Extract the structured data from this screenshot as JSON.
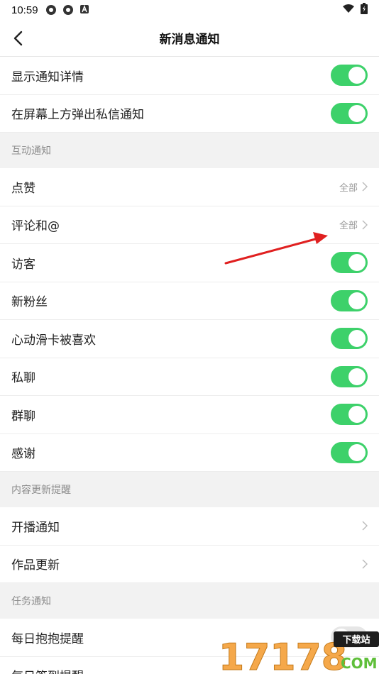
{
  "status": {
    "time": "10:59"
  },
  "nav": {
    "title": "新消息通知"
  },
  "general": [
    {
      "label": "显示通知详情",
      "on": true
    },
    {
      "label": "在屏幕上方弹出私信通知",
      "on": true
    }
  ],
  "interaction": {
    "header": "互动通知",
    "items": [
      {
        "label": "点赞",
        "value": "全部"
      },
      {
        "label": "评论和@",
        "value": "全部"
      },
      {
        "label": "访客",
        "on": true
      },
      {
        "label": "新粉丝",
        "on": true
      },
      {
        "label": "心动滑卡被喜欢",
        "on": true
      },
      {
        "label": "私聊",
        "on": true
      },
      {
        "label": "群聊",
        "on": true
      },
      {
        "label": "感谢",
        "on": true
      }
    ]
  },
  "content_updates": {
    "header": "内容更新提醒",
    "items": [
      {
        "label": "开播通知"
      },
      {
        "label": "作品更新"
      }
    ]
  },
  "tasks": {
    "header": "任务通知",
    "items": [
      {
        "label": "每日抱抱提醒",
        "on": false
      },
      {
        "label": "每日签到提醒"
      }
    ]
  },
  "watermark": {
    "text": "17178",
    "badge": "下载站",
    "suffix": "COM"
  },
  "colors": {
    "toggle_on": "#3dd16a",
    "arrow": "#e02020"
  }
}
